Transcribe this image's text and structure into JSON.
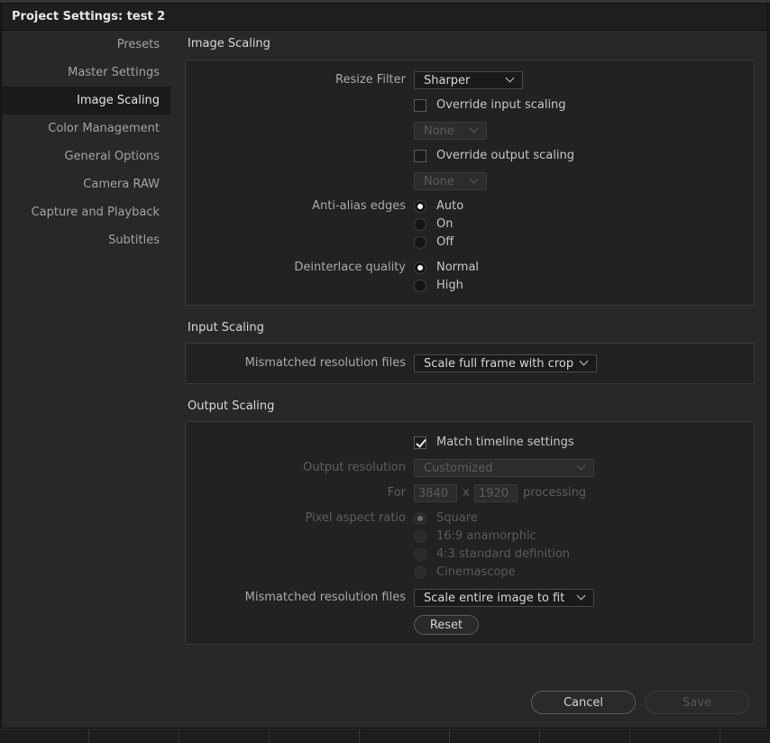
{
  "window": {
    "title": "Project Settings:  test 2"
  },
  "sidebar": {
    "items": [
      {
        "label": "Presets"
      },
      {
        "label": "Master Settings"
      },
      {
        "label": "Image Scaling"
      },
      {
        "label": "Color Management"
      },
      {
        "label": "General Options"
      },
      {
        "label": "Camera RAW"
      },
      {
        "label": "Capture and Playback"
      },
      {
        "label": "Subtitles"
      }
    ],
    "active_item": "Image Scaling"
  },
  "image_scaling": {
    "title": "Image Scaling",
    "resize_filter": {
      "label": "Resize Filter",
      "value": "Sharper"
    },
    "override_input": {
      "label": "Override input scaling",
      "checked": false,
      "dropdown": "None"
    },
    "override_output": {
      "label": "Override output scaling",
      "checked": false,
      "dropdown": "None"
    },
    "anti_alias": {
      "label": "Anti-alias edges",
      "options": [
        "Auto",
        "On",
        "Off"
      ],
      "selected": "Auto"
    },
    "deinterlace": {
      "label": "Deinterlace quality",
      "options": [
        "Normal",
        "High"
      ],
      "selected": "Normal"
    }
  },
  "input_scaling": {
    "title": "Input Scaling",
    "mismatched": {
      "label": "Mismatched resolution files",
      "value": "Scale full frame with crop"
    }
  },
  "output_scaling": {
    "title": "Output Scaling",
    "match_timeline": {
      "label": "Match timeline settings",
      "checked": true
    },
    "output_resolution": {
      "label": "Output resolution",
      "value": "Customized"
    },
    "for": {
      "label": "For",
      "width": "3840",
      "x": "x",
      "height": "1920",
      "suffix": "processing"
    },
    "pixel_aspect": {
      "label": "Pixel aspect ratio",
      "options": [
        "Square",
        "16:9 anamorphic",
        "4:3 standard definition",
        "Cinemascope"
      ],
      "selected": "Square"
    },
    "mismatched": {
      "label": "Mismatched resolution files",
      "value": "Scale entire image to fit"
    },
    "reset_label": "Reset"
  },
  "footer": {
    "cancel_label": "Cancel",
    "save_label": "Save"
  },
  "colors": {
    "accent_text": "#e4e4e4",
    "panel_bg": "#222224",
    "window_bg": "#28282a"
  }
}
